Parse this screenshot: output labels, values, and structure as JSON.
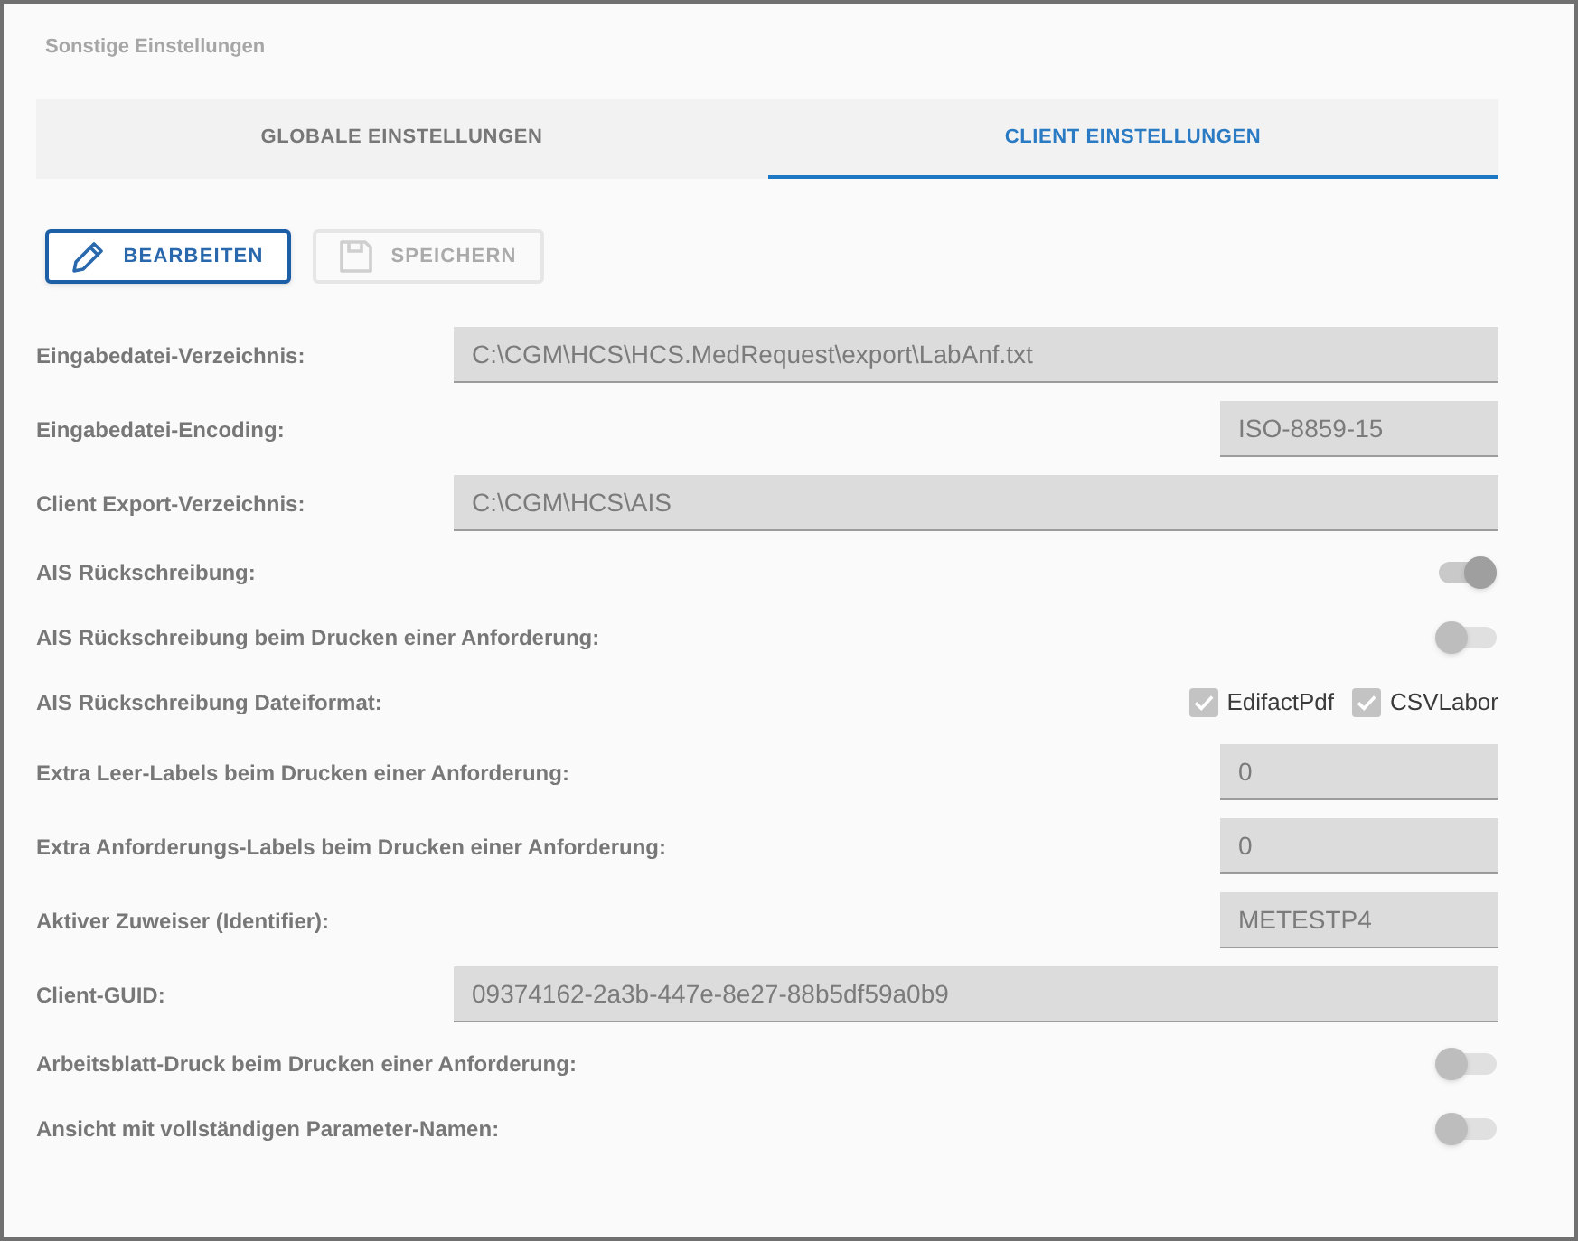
{
  "window": {
    "title": "Sonstige Einstellungen"
  },
  "tabs": [
    {
      "label": "GLOBALE EINSTELLUNGEN",
      "selected": false
    },
    {
      "label": "CLIENT EINSTELLUNGEN",
      "selected": true
    }
  ],
  "toolbar": [
    {
      "kind": "edit",
      "label": "BEARBEITEN",
      "disabled": false
    },
    {
      "kind": "save",
      "label": "SPEICHERN",
      "disabled": true
    }
  ],
  "settings": [
    {
      "kind": "wide_field",
      "label": "Eingabedatei-Verzeichnis:",
      "value": "C:\\CGM\\HCS\\HCS.MedRequest\\export\\LabAnf.txt"
    },
    {
      "kind": "short_field",
      "label": "Eingabedatei-Encoding:",
      "value": "ISO-8859-15"
    },
    {
      "kind": "wide_field",
      "label": "Client Export-Verzeichnis:",
      "value": "C:\\CGM\\HCS\\AIS"
    },
    {
      "kind": "toggle",
      "label": "AIS Rückschreibung:",
      "on": true
    },
    {
      "kind": "toggle",
      "label": "AIS Rückschreibung beim Drucken einer Anforderung:",
      "on": false
    },
    {
      "kind": "checkboxes",
      "label": "AIS Rückschreibung Dateiformat:",
      "options": [
        {
          "label": "EdifactPdf",
          "checked": true
        },
        {
          "label": "CSVLabor",
          "checked": true
        }
      ]
    },
    {
      "kind": "short_field",
      "label": "Extra Leer-Labels beim Drucken einer Anforderung:",
      "value": "0"
    },
    {
      "kind": "short_field",
      "label": "Extra Anforderungs-Labels beim Drucken einer Anforderung:",
      "value": "0"
    },
    {
      "kind": "short_field",
      "label": "Aktiver Zuweiser (Identifier):",
      "value": "METESTP4"
    },
    {
      "kind": "wide_field",
      "label": "Client-GUID:",
      "value": "09374162-2a3b-447e-8e27-88b5df59a0b9"
    },
    {
      "kind": "toggle",
      "label": "Arbeitsblatt-Druck beim Drucken einer Anforderung:",
      "on": false
    },
    {
      "kind": "toggle",
      "label": "Ansicht mit vollständigen Parameter-Namen:",
      "on": false
    }
  ]
}
